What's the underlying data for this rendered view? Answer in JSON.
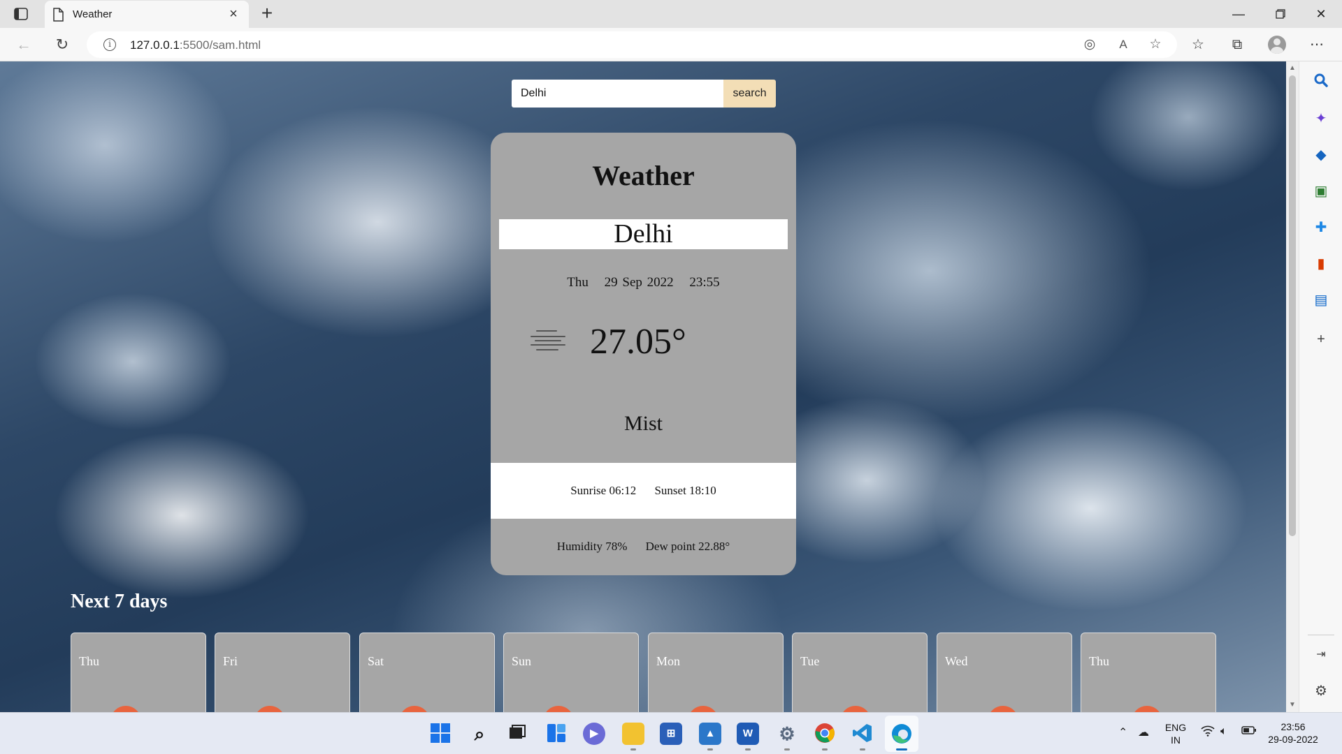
{
  "browser": {
    "tab_title": "Weather",
    "url_host": "127.0.0.1",
    "url_path": ":5500/sam.html"
  },
  "search": {
    "value": "Delhi",
    "button_label": "search"
  },
  "weather": {
    "title": "Weather",
    "city": "Delhi",
    "day": "Thu",
    "date": "29 Sep 2022",
    "time": "23:55",
    "temperature": "27.05°",
    "condition": "Mist",
    "condition_icon": "mist-icon",
    "sunrise": "Sunrise 06:12",
    "sunset": "Sunset 18:10",
    "humidity": "Humidity 78%",
    "dew_point": "Dew point 22.88°"
  },
  "forecast": {
    "title": "Next 7 days",
    "days": [
      "Thu",
      "Fri",
      "Sat",
      "Sun",
      "Mon",
      "Tue",
      "Wed",
      "Thu"
    ]
  },
  "taskbar": {
    "language_line1": "ENG",
    "language_line2": "IN",
    "clock_time": "23:56",
    "clock_date": "29-09-2022"
  },
  "colors": {
    "card_bg": "#a6a6a6",
    "search_button_bg": "#f3deb6",
    "day_sun": "#e8643e"
  }
}
